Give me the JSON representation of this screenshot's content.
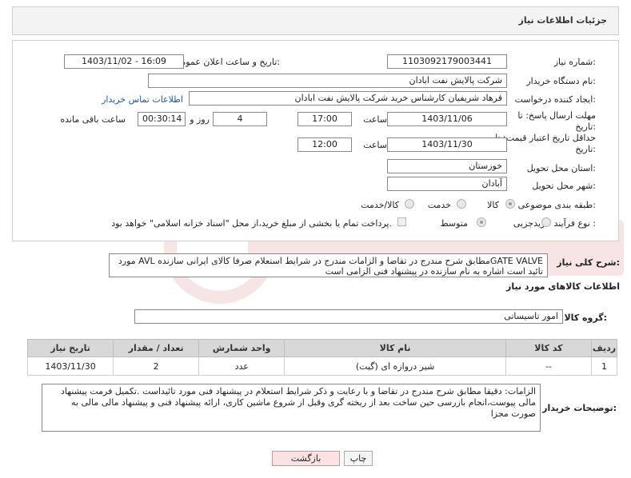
{
  "header": {
    "title": "جزئیات اطلاعات نیاز"
  },
  "form": {
    "need_number_label": "شماره نیاز:",
    "need_number": "1103092179003441",
    "announce_label": "تاریخ و ساعت اعلان عمومی:",
    "announce_value": "1403/11/02 - 16:09",
    "buyer_org_label": "نام دستگاه خریدار:",
    "buyer_org": "شرکت پالایش نفت ابادان",
    "creator_label": "ایجاد کننده درخواست:",
    "creator": "فرهاد شریفیان کارشناس خرید شرکت پالایش نفت ابادان",
    "contact_link": "اطلاعات تماس خریدار",
    "deadline_label": "مهلت ارسال پاسخ: تا تاریخ:",
    "deadline_date": "1403/11/06",
    "time_label": "ساعت",
    "deadline_time": "17:00",
    "days_value": "4",
    "days_label": "روز و",
    "remaining_time": "00:30:14",
    "remaining_label": "ساعت باقی مانده",
    "validity_label": "حداقل تاریخ اعتبار قیمت: تا تاریخ:",
    "validity_date": "1403/11/30",
    "validity_time": "12:00",
    "province_label": "استان محل تحویل:",
    "province": "خوزستان",
    "city_label": "شهر محل تحویل:",
    "city": "آبادان",
    "category_label": "طبقه بندی موضوعی:",
    "category_options": [
      "کالا",
      "خدمت",
      "کالا/خدمت"
    ],
    "process_label": "نوع فرآیند خرید :",
    "process_options": [
      "جزیی",
      "متوسط"
    ],
    "payment_note": "پرداخت تمام یا بخشی از مبلغ خرید،از محل \"اسناد خزانه اسلامی\" خواهد بود."
  },
  "description": {
    "label": "شرح کلی نیاز:",
    "text": "GATE VALVEمطابق شرح مندرج در تقاضا و الزامات مندرج در شرایط استعلام صرفا کالای ایرانی سازنده AVL  مورد تائید است اشاره به نام سازنده در پیشنهاد فنی الزامی است"
  },
  "goods": {
    "section_title": "اطلاعات کالاهای مورد نیاز",
    "group_label": "گروه کالا:",
    "group_value": "امور تاسیساتی",
    "columns": [
      "ردیف",
      "کد کالا",
      "نام کالا",
      "واحد شمارش",
      "تعداد / مقدار",
      "تاریخ نیاز"
    ],
    "rows": [
      {
        "row": "1",
        "code": "--",
        "name": "شیر دروازه ای (گیت)",
        "unit": "عدد",
        "qty": "2",
        "date": "1403/11/30"
      }
    ]
  },
  "buyer_notes": {
    "label": "توضیحات خریدار:",
    "text": "الزامات: دقیقا مطابق شرح مندرج در تقاضا و با رعایت و ذکر شرایط استعلام در پیشنهاد فنی مورد تائیداست .تکمیل فرمت پیشنهاد مالی پیوست،انجام بازرسی حین ساخت بعد از ریخته گری وقبل از شروع ماشین کاری، ارائه پیشنهاد فنی و پیشنهاد مالی مالی به صورت مجزا"
  },
  "buttons": {
    "print": "چاپ",
    "back": "بازگشت"
  }
}
